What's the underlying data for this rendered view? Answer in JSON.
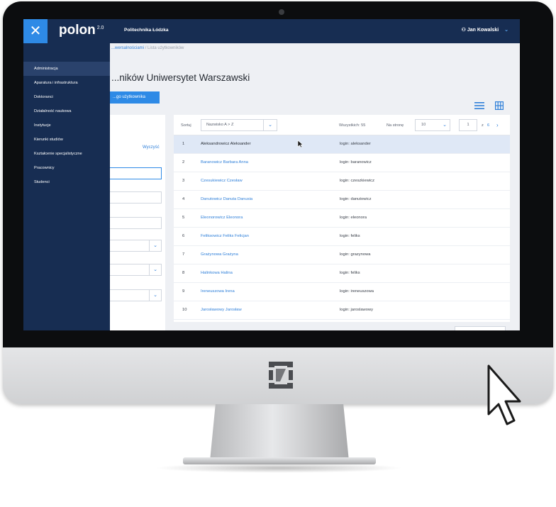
{
  "app": {
    "brand": "polon",
    "brand_version": "2.0",
    "university": "Politechnika Łódzka",
    "user_name": "Jan Kowalski",
    "close_icon": "close-icon",
    "user_icon": "user-icon"
  },
  "sidebar": {
    "items": [
      {
        "label": "Administracja",
        "active": true
      },
      {
        "label": "Aparatura i infrastruktura"
      },
      {
        "label": "Doktoranci"
      },
      {
        "label": "Działalność naukowa"
      },
      {
        "label": "Instytucje"
      },
      {
        "label": "Kierunki studiów"
      },
      {
        "label": "Kształcenie specjalistyczne"
      },
      {
        "label": "Pracownicy"
      },
      {
        "label": "Studenci"
      }
    ]
  },
  "breadcrumb": {
    "parent": "...wersalnościami",
    "separator": "/",
    "current": "Lista użytkowników"
  },
  "page": {
    "title": "...ników Uniwersytet Warszawski",
    "add_button": "...go użytkownika"
  },
  "filters": {
    "clear_label": "Wyczyść"
  },
  "toolbar": {
    "sort_label": "Sortuj",
    "sort_value": "Nazwisko A > Z",
    "total_label": "Wszystkich: 55",
    "per_page_label": "Na stronę",
    "per_page_value": "10",
    "current_page": "1",
    "page_of": "z",
    "page_total": "6",
    "next_icon": "chevron-right-icon"
  },
  "table": {
    "rows": [
      {
        "num": "1",
        "name": "Aleksandrowicz Aleksander",
        "login": "login: aleksander",
        "selected": true
      },
      {
        "num": "2",
        "name": "Baranowicz Barbara Anna",
        "login": "login: baranowicz"
      },
      {
        "num": "3",
        "name": "Czesukiewicz Czesław",
        "login": "login: czeszkiewicz"
      },
      {
        "num": "4",
        "name": "Danutowicz Danuta Danusia",
        "login": "login: danutowicz"
      },
      {
        "num": "5",
        "name": "Eleonorowicz Eleonora",
        "login": "login: eleonora"
      },
      {
        "num": "6",
        "name": "Feliksowicz Feliks Felicjan",
        "login": "login: feliks"
      },
      {
        "num": "7",
        "name": "Grażynowa Grażyna",
        "login": "login: grazynowa"
      },
      {
        "num": "8",
        "name": "Halinkowa Halina",
        "login": "login: feliks"
      },
      {
        "num": "9",
        "name": "Ireneuszowa Irena",
        "login": "login: ireneuszowa"
      },
      {
        "num": "10",
        "name": "Jarosławowy Jarosław",
        "login": "login: jaroslawowy"
      }
    ]
  },
  "colors": {
    "navy": "#172d52",
    "accent": "#2e8ae6",
    "selected_row": "#dfe8f6"
  }
}
